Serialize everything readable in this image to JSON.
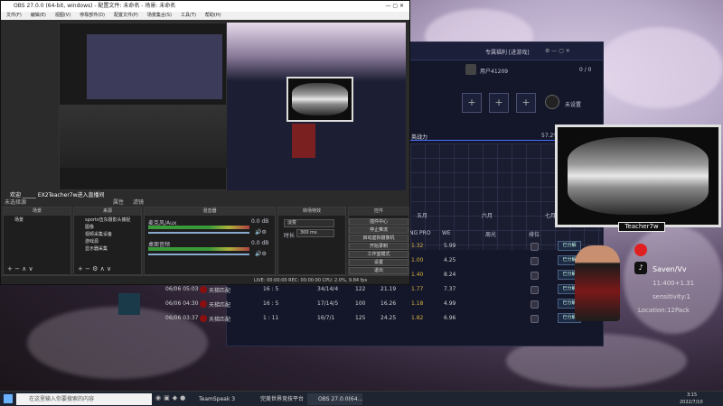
{
  "obs": {
    "title": "OBS 27.0.0 (64-bit, windows) - 配置文件: 未命名 - 场景: 未命名",
    "menu": [
      "文件(F)",
      "编辑(E)",
      "视图(V)",
      "停靠部件(D)",
      "配置文件(P)",
      "场景集合(S)",
      "工具(T)",
      "帮助(H)"
    ],
    "status_bar": "LIVE: 00:00:00   REC: 00:00:00   CPU: 2.0%, 9.84 fps",
    "panels": {
      "scenes": {
        "header": "场景",
        "items": [
          "场景"
        ]
      },
      "sources": {
        "header": "来源",
        "items": [
          "sports伍东摄影头捕捉",
          "图像",
          "视频采集设备",
          "游戏源",
          "显示器采集"
        ]
      },
      "mixer": {
        "header": "混音器",
        "tracks": [
          {
            "name": "麦克风/Aux",
            "level": "0.0 dB"
          },
          {
            "name": "桌面音频",
            "level": "0.0 dB"
          }
        ]
      },
      "transitions": {
        "header": "转场特效",
        "type": "淡变",
        "duration_label": "时长",
        "duration": "300 ms"
      },
      "controls": {
        "header": "控件",
        "buttons": [
          "插件中心",
          "停止推流",
          "启动虚拟摄像机",
          "开始录制",
          "工作室模式",
          "设置",
          "退出"
        ]
      }
    },
    "chat_line": "欢迎 _____ EX2Teacher7w进入直播间",
    "scene_label": "未选择源",
    "props_label": "属性",
    "filters_label": "滤镜"
  },
  "game": {
    "top_label": "专属福利 [进游戏]",
    "user": "用户41209",
    "counter": "0 / 0",
    "unbound": "未设置",
    "section": "英战力",
    "section_right": "57.2%",
    "months": [
      "五月",
      "六月",
      "七月"
    ],
    "col_headers": [
      "NG PRO",
      "WE",
      "周光",
      "排位"
    ],
    "rows": [
      {
        "date": "",
        "mode": "",
        "score": "",
        "kda": "",
        "n1": "",
        "n2": "1.32",
        "n3": "5.99",
        "btn": "已分解"
      },
      {
        "date": "",
        "mode": "",
        "score": "",
        "kda": "",
        "n1": "",
        "n2": "1.00",
        "n3": "4.25",
        "btn": "已分解"
      },
      {
        "date": "",
        "mode": "",
        "score": "",
        "kda": "",
        "n1": "",
        "n2": "1.40",
        "n3": "8.24",
        "btn": "已分解"
      },
      {
        "date": "06/06 05:03",
        "mode": "天梯匹配",
        "score": "16 : 5",
        "kda": "34/14/4",
        "n1": "122",
        "n1b": "21.19",
        "n2": "1.77",
        "n3": "7.37",
        "btn": "已分解"
      },
      {
        "date": "06/06 04:30",
        "mode": "天梯匹配",
        "score": "16 : 5",
        "kda": "17/14/5",
        "n1": "100",
        "n1b": "16.26",
        "n2": "1.18",
        "n3": "4.99",
        "btn": "已分解"
      },
      {
        "date": "06/06 03:37",
        "mode": "天梯匹配",
        "score": "1 : 11",
        "kda": "16/7/1",
        "n1": "125",
        "n1b": "24.25",
        "n2": "1.82",
        "n3": "6.96",
        "btn": "已分解"
      }
    ]
  },
  "overlay": {
    "name_tag": "Teacher7w",
    "social": "Saven/Vv",
    "line1": "11:400+1.31",
    "line2": "Location:12Pack",
    "line3": "sensitivity:1"
  },
  "taskbar": {
    "search_placeholder": "在这里输入你要搜索的内容",
    "apps": [
      "TeamSpeak 3",
      "完美世界竞技平台",
      "OBS 27.0.0(64..."
    ],
    "time": "3:15",
    "date": "2022/7/10"
  },
  "colors": {
    "obs_bg": "#2b2b2b",
    "game_bg": "#14172a",
    "accent_green": "#6ad46a",
    "accent_yellow": "#e0c040"
  }
}
